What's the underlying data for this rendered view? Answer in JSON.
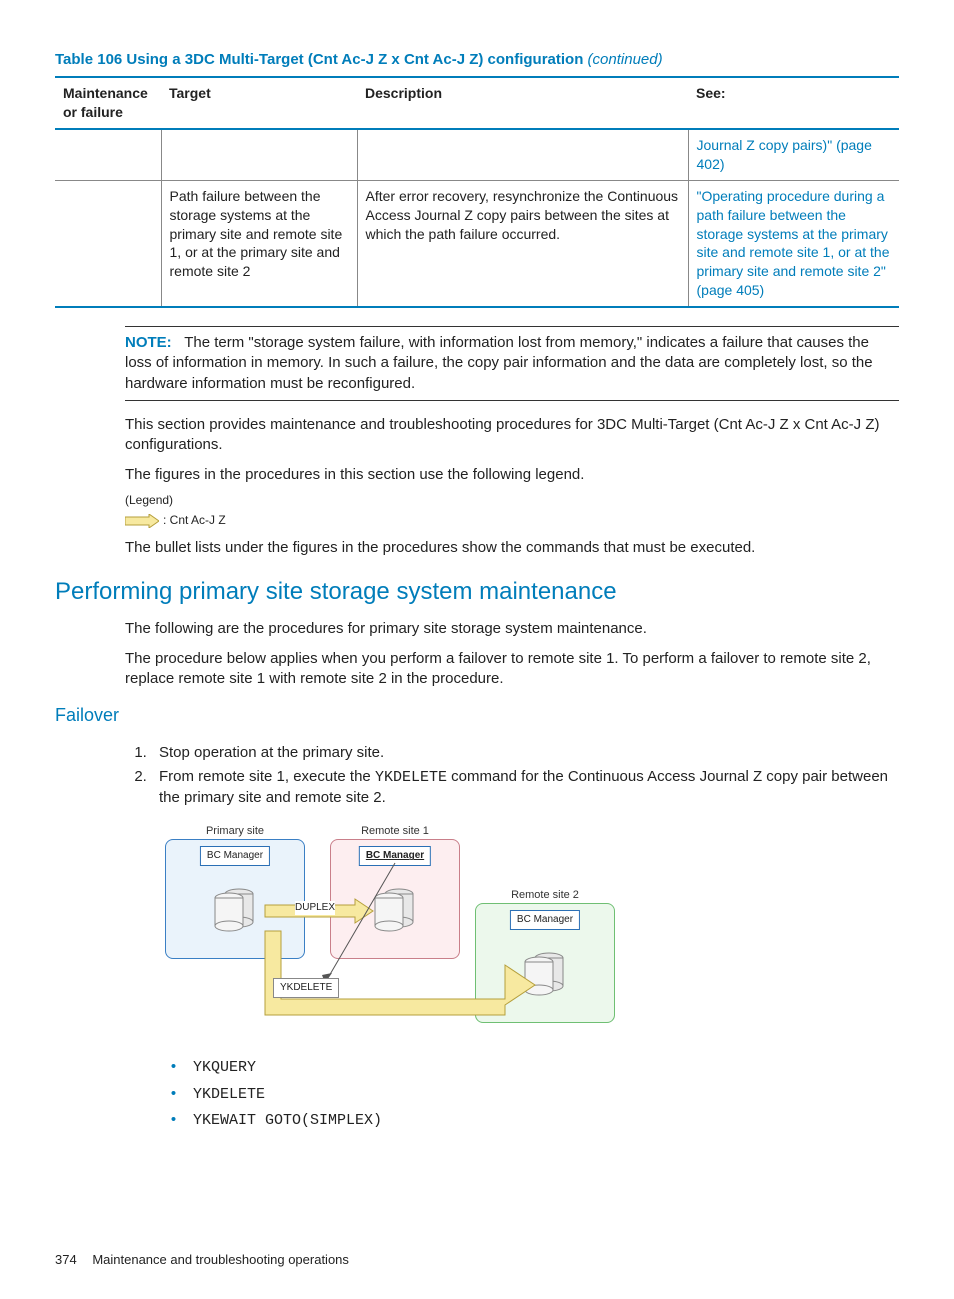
{
  "table": {
    "title_prefix": "Table 106 Using a 3DC Multi-Target (Cnt Ac-J Z x Cnt Ac-J Z) configuration",
    "continued": " (continued)",
    "headers": {
      "c1": "Maintenance or failure",
      "c2": "Target",
      "c3": "Description",
      "c4": "See:"
    },
    "row1": {
      "c4": "Journal Z copy pairs)\" (page 402)"
    },
    "row2": {
      "c2": "Path failure between the storage systems at the primary site and remote site 1, or at the primary site and remote site 2",
      "c3": "After error recovery, resynchronize the Continuous Access Journal Z copy pairs between the sites at which the path failure occurred.",
      "c4": "\"Operating procedure during a path failure between the storage systems at the primary site and remote site 1, or at the primary site and remote site 2\" (page 405)"
    }
  },
  "note": {
    "label": "NOTE:",
    "text": "The term \"storage system failure, with information lost from memory,\" indicates a failure that causes the loss of information in memory. In such a failure, the copy pair information and the data are completely lost, so the hardware information must be reconfigured."
  },
  "para1": "This section provides maintenance and troubleshooting procedures for 3DC Multi-Target (Cnt Ac-J Z x Cnt Ac-J Z) configurations.",
  "para2": "The figures in the procedures in this section use the following legend.",
  "legend": {
    "title": "(Legend)",
    "label": ": Cnt Ac-J Z"
  },
  "para3": "The bullet lists under the figures in the procedures show the commands that must be executed.",
  "h2": "Performing primary site storage system maintenance",
  "para4": "The following are the procedures for primary site storage system maintenance.",
  "para5": "The procedure below applies when you perform a failover to remote site 1. To perform a failover to remote site 2, replace remote site 1 with remote site 2 in the procedure.",
  "h3": "Failover",
  "steps": {
    "s1": "Stop operation at the primary site.",
    "s2a": "From remote site 1, execute the ",
    "s2_cmd": "YKDELETE",
    "s2b": " command for the Continuous Access Journal Z copy pair between the primary site and remote site 2."
  },
  "diagram": {
    "primary": "Primary site",
    "remote1": "Remote site 1",
    "remote2": "Remote site 2",
    "bc": "BC Manager",
    "duplex": "DUPLEX",
    "ykdelete": "YKDELETE"
  },
  "cmds": {
    "c1": "YKQUERY",
    "c2": "YKDELETE",
    "c3": "YKEWAIT GOTO(SIMPLEX)"
  },
  "footer": {
    "page": "374",
    "title": "Maintenance and troubleshooting operations"
  }
}
